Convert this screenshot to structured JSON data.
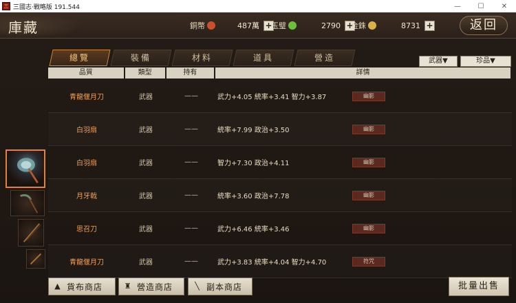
{
  "window": {
    "title": "三國志·戰略版 191.544",
    "controls": [
      "—",
      "☐",
      "✕"
    ]
  },
  "header": {
    "title": "庫藏",
    "back_label": "返回",
    "currencies": [
      {
        "label": "銅幣",
        "amount": "487萬",
        "color": "#c9502a"
      },
      {
        "label": "玉璧",
        "amount": "2790",
        "color": "#6fbf3a"
      },
      {
        "label": "金銖",
        "amount": "8731",
        "color": "#d9b24a"
      }
    ],
    "plus": "+"
  },
  "tabs": [
    "總覽",
    "裝備",
    "材料",
    "道具",
    "營造"
  ],
  "active_tab": "總覽",
  "filters": {
    "weapon": "武器▼",
    "rarity": "珍品▼"
  },
  "columns": {
    "quality": "品質",
    "type": "類型",
    "owned": "持有",
    "detail": "詳情"
  },
  "items": [
    {
      "name": "青龍偃月刀",
      "type": "武器",
      "owned": "——",
      "detail": "武力+4.05  統率+3.41  智力+3.87",
      "tag": "幽影"
    },
    {
      "name": "白羽扇",
      "type": "武器",
      "owned": "——",
      "detail": "統率+7.99  政治+3.50",
      "tag": "幽影"
    },
    {
      "name": "白羽扇",
      "type": "武器",
      "owned": "——",
      "detail": "智力+7.30  政治+4.11",
      "tag": "幽影"
    },
    {
      "name": "月牙戟",
      "type": "武器",
      "owned": "——",
      "detail": "統率+3.60  政治+7.78",
      "tag": "幽影"
    },
    {
      "name": "思召刀",
      "type": "武器",
      "owned": "——",
      "detail": "武力+6.46  統率+3.46",
      "tag": "幽影"
    },
    {
      "name": "青龍偃月刀",
      "type": "武器",
      "owned": "——",
      "detail": "武力+3.83  統率+4.04  智力+4.70",
      "tag": "符咒"
    }
  ],
  "shops": [
    {
      "label": "貨布商店",
      "icon": "coin-pouch-icon"
    },
    {
      "label": "營造商店",
      "icon": "building-icon"
    },
    {
      "label": "副本商店",
      "icon": "sword-icon"
    }
  ],
  "batch_sell": "批量出售"
}
